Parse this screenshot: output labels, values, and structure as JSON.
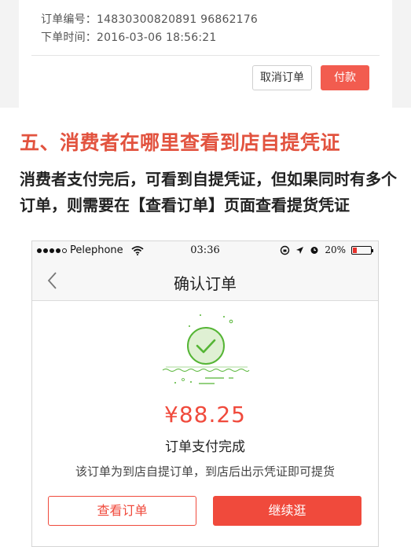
{
  "order": {
    "number_label": "订单编号：",
    "number_value": "14830300820891 96862176",
    "time_label": "下单时间：",
    "time_value": "2016-03-06 18:56:21",
    "cancel_label": "取消订单",
    "pay_label": "付款"
  },
  "section": {
    "title": "五、消费者在哪里查看到店自提凭证",
    "description": "消费者支付完后，可看到自提凭证，但如果同时有多个订单，则需要在【查看订单】页面查看提货凭证"
  },
  "phone": {
    "carrier": "Pelephone",
    "time": "03:36",
    "battery": "20%",
    "nav_title": "确认订单",
    "amount": "¥88.25",
    "status": "订单支付完成",
    "hint": "该订单为到店自提订单，到店后出示凭证即可提货",
    "view_order_label": "查看订单",
    "continue_label": "继续逛"
  },
  "colors": {
    "accent": "#f04a3c",
    "success_green": "#55b535",
    "title_red": "#e2533f"
  },
  "icons": [
    "back-chevron-icon",
    "wifi-icon",
    "location-icon",
    "alarm-icon",
    "battery-icon",
    "success-check-icon"
  ]
}
